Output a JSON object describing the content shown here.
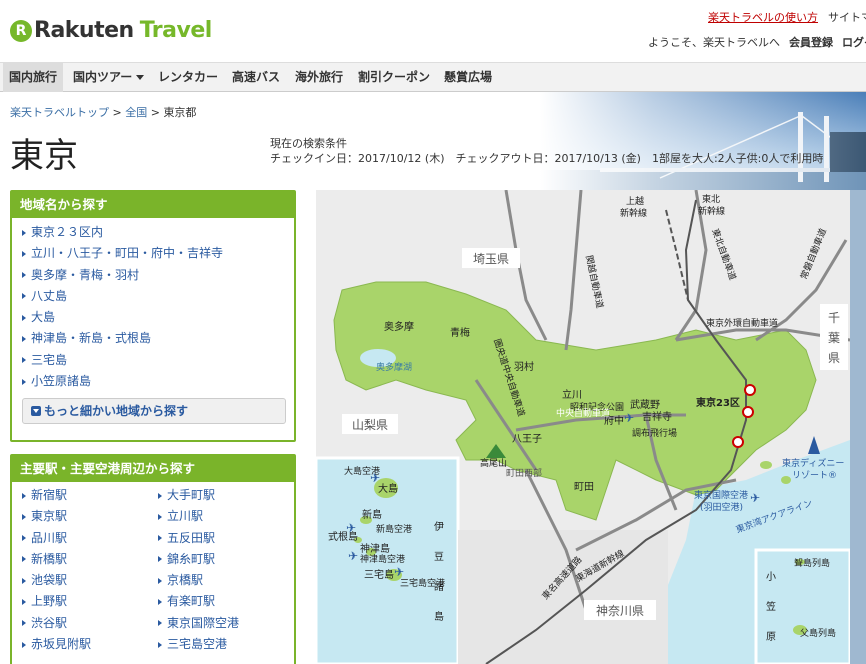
{
  "header": {
    "logo_rakuten": "Rakuten",
    "logo_travel": "Travel",
    "link_howto": "楽天トラベルの使い方",
    "link_sitemap": "サイトマ",
    "welcome": "ようこそ、楽天トラベルへ",
    "register": "会員登録",
    "login": "ログイ"
  },
  "nav": [
    {
      "label": "国内旅行"
    },
    {
      "label": "国内ツアー"
    },
    {
      "label": "レンタカー"
    },
    {
      "label": "高速バス"
    },
    {
      "label": "海外旅行"
    },
    {
      "label": "割引クーポン"
    },
    {
      "label": "懸賞広場"
    }
  ],
  "breadcrumb": {
    "top": "楽天トラベルトップ",
    "all": "全国",
    "current": "東京都",
    "sep": ">"
  },
  "page_title": "東京",
  "search_conditions": {
    "heading": "現在の検索条件",
    "detail": "チェックイン日：2017/10/12 (木)　チェックアウト日：2017/10/13 (金)　1部屋を大人:2人子供:0人で利用時"
  },
  "region_panel": {
    "title": "地域名から探す",
    "items": [
      "東京２３区内",
      "立川・八王子・町田・府中・吉祥寺",
      "奥多摩・青梅・羽村",
      "八丈島",
      "大島",
      "神津島・新島・式根島",
      "三宅島",
      "小笠原諸島"
    ],
    "more_button": "もっと細かい地域から探す"
  },
  "station_panel": {
    "title": "主要駅・主要空港周辺から探す",
    "left": [
      "新宿駅",
      "東京駅",
      "品川駅",
      "新橋駅",
      "池袋駅",
      "上野駅",
      "渋谷駅",
      "赤坂見附駅"
    ],
    "right": [
      "大手町駅",
      "立川駅",
      "五反田駅",
      "錦糸町駅",
      "京橋駅",
      "有楽町駅",
      "東京国際空港",
      "三宅島空港"
    ]
  },
  "map": {
    "prefectures": {
      "saitama": "埼玉県",
      "yamanashi": "山梨県",
      "kanagawa": "神奈川県",
      "chiba1": "千",
      "chiba2": "葉",
      "chiba3": "県"
    },
    "places": {
      "okutama": "奥多摩",
      "ome": "青梅",
      "okutamako": "奥多摩湖",
      "hamura": "羽村",
      "tachikawa": "立川",
      "showa": "昭和記念公園",
      "musashino": "武蔵野",
      "kichijoji": "吉祥寺",
      "fuchu": "府中",
      "chofu": "調布飛行場",
      "hachioji": "八王子",
      "takao": "高尾山",
      "machidanishi": "町田西部",
      "machida": "町田",
      "tokyo23": "東京23区",
      "disney1": "東京ディズニー",
      "disney2": "リゾート®",
      "haneda1": "東京国際空港",
      "haneda2": "(羽田空港)",
      "aqualine": "東京湾アクアライン",
      "oshima_ap": "大島空港",
      "oshima": "大島",
      "niijima": "新島",
      "niijima_ap": "新島空港",
      "shikine": "式根島",
      "kozu": "神津島",
      "kozu_ap": "神津島空港",
      "miyake": "三宅島",
      "miyake_ap": "三宅島空港",
      "joshinetsu1": "上越",
      "joshinetsu2": "新幹線",
      "tohoku1": "東北",
      "tohoku2": "新幹線",
      "tohoku_exp": "東北自動車道",
      "kanetsu": "関越自動車道",
      "joban": "常磐自動車道",
      "gaikan": "東京外環自動車道",
      "ken_o": "圏央道中央自動車道",
      "chuo": "中央自動車道",
      "tomei": "東名高速道路",
      "tokaido": "東海道新幹線",
      "izu": [
        "伊",
        "豆",
        "諸",
        "島"
      ],
      "ogasawara": [
        "小",
        "笠",
        "原"
      ],
      "mukojima": "聟島列島",
      "chichijima": "父島列島"
    }
  },
  "colors": {
    "brand_green": "#76b82a",
    "panel_green": "#7ab42a",
    "link_blue": "#2a5aa0",
    "alert_red": "#bf0000",
    "map_land": "#a9d46a",
    "map_sea": "#c6e8f2"
  }
}
